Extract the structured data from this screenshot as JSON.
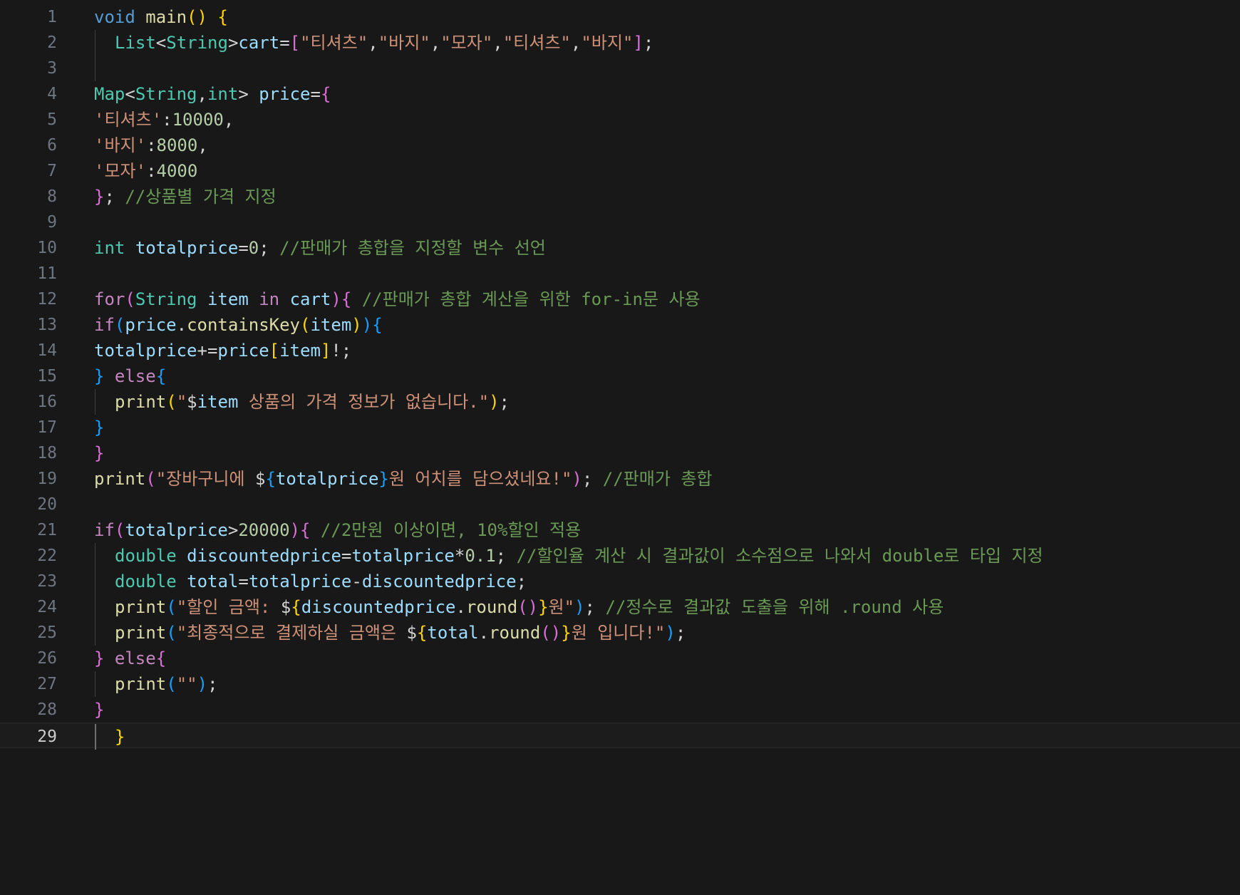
{
  "editor": {
    "lines": [
      {
        "n": "1",
        "indent": 0,
        "tokens": [
          {
            "t": "void",
            "c": "kw"
          },
          {
            "t": " ",
            "c": "pn"
          },
          {
            "t": "main",
            "c": "fn"
          },
          {
            "t": "()",
            "c": "b1"
          },
          {
            "t": " ",
            "c": "pn"
          },
          {
            "t": "{",
            "c": "b1"
          }
        ]
      },
      {
        "n": "2",
        "indent": 1,
        "tokens": [
          {
            "t": "List",
            "c": "ty"
          },
          {
            "t": "<",
            "c": "pn"
          },
          {
            "t": "String",
            "c": "ty"
          },
          {
            "t": ">",
            "c": "pn"
          },
          {
            "t": "cart",
            "c": "var"
          },
          {
            "t": "=",
            "c": "pn"
          },
          {
            "t": "[",
            "c": "b2"
          },
          {
            "t": "\"티셔츠\"",
            "c": "str"
          },
          {
            "t": ",",
            "c": "pn"
          },
          {
            "t": "\"바지\"",
            "c": "str"
          },
          {
            "t": ",",
            "c": "pn"
          },
          {
            "t": "\"모자\"",
            "c": "str"
          },
          {
            "t": ",",
            "c": "pn"
          },
          {
            "t": "\"티셔츠\"",
            "c": "str"
          },
          {
            "t": ",",
            "c": "pn"
          },
          {
            "t": "\"바지\"",
            "c": "str"
          },
          {
            "t": "]",
            "c": "b2"
          },
          {
            "t": ";",
            "c": "pn"
          }
        ]
      },
      {
        "n": "3",
        "indent": 1,
        "tokens": []
      },
      {
        "n": "4",
        "indent": 0,
        "tokens": [
          {
            "t": "Map",
            "c": "ty"
          },
          {
            "t": "<",
            "c": "pn"
          },
          {
            "t": "String",
            "c": "ty"
          },
          {
            "t": ",",
            "c": "pn"
          },
          {
            "t": "int",
            "c": "ty"
          },
          {
            "t": "> ",
            "c": "pn"
          },
          {
            "t": "price",
            "c": "var"
          },
          {
            "t": "=",
            "c": "pn"
          },
          {
            "t": "{",
            "c": "b2"
          }
        ]
      },
      {
        "n": "5",
        "indent": 0,
        "tokens": [
          {
            "t": "'티셔츠'",
            "c": "str"
          },
          {
            "t": ":",
            "c": "pn"
          },
          {
            "t": "10000",
            "c": "num"
          },
          {
            "t": ",",
            "c": "pn"
          }
        ]
      },
      {
        "n": "6",
        "indent": 0,
        "tokens": [
          {
            "t": "'바지'",
            "c": "str"
          },
          {
            "t": ":",
            "c": "pn"
          },
          {
            "t": "8000",
            "c": "num"
          },
          {
            "t": ",",
            "c": "pn"
          }
        ]
      },
      {
        "n": "7",
        "indent": 0,
        "tokens": [
          {
            "t": "'모자'",
            "c": "str"
          },
          {
            "t": ":",
            "c": "pn"
          },
          {
            "t": "4000",
            "c": "num"
          }
        ]
      },
      {
        "n": "8",
        "indent": 0,
        "tokens": [
          {
            "t": "}",
            "c": "b2"
          },
          {
            "t": "; ",
            "c": "pn"
          },
          {
            "t": "//상품별 가격 지정",
            "c": "cm"
          }
        ]
      },
      {
        "n": "9",
        "indent": 0,
        "tokens": []
      },
      {
        "n": "10",
        "indent": 0,
        "tokens": [
          {
            "t": "int",
            "c": "ty"
          },
          {
            "t": " ",
            "c": "pn"
          },
          {
            "t": "totalprice",
            "c": "var"
          },
          {
            "t": "=",
            "c": "pn"
          },
          {
            "t": "0",
            "c": "num"
          },
          {
            "t": "; ",
            "c": "pn"
          },
          {
            "t": "//판매가 총합을 지정할 변수 선언",
            "c": "cm"
          }
        ]
      },
      {
        "n": "11",
        "indent": 0,
        "tokens": []
      },
      {
        "n": "12",
        "indent": 0,
        "tokens": [
          {
            "t": "for",
            "c": "ctrl"
          },
          {
            "t": "(",
            "c": "b2"
          },
          {
            "t": "String",
            "c": "ty"
          },
          {
            "t": " ",
            "c": "pn"
          },
          {
            "t": "item",
            "c": "var"
          },
          {
            "t": " ",
            "c": "pn"
          },
          {
            "t": "in",
            "c": "ctrl"
          },
          {
            "t": " ",
            "c": "pn"
          },
          {
            "t": "cart",
            "c": "var"
          },
          {
            "t": "){",
            "c": "b2"
          },
          {
            "t": " ",
            "c": "pn"
          },
          {
            "t": "//판매가 총합 계산을 위한 for-in문 사용",
            "c": "cm"
          }
        ]
      },
      {
        "n": "13",
        "indent": 0,
        "tokens": [
          {
            "t": "if",
            "c": "ctrl"
          },
          {
            "t": "(",
            "c": "b3"
          },
          {
            "t": "price",
            "c": "var"
          },
          {
            "t": ".",
            "c": "pn"
          },
          {
            "t": "containsKey",
            "c": "fn"
          },
          {
            "t": "(",
            "c": "b1"
          },
          {
            "t": "item",
            "c": "var"
          },
          {
            "t": ")",
            "c": "b1"
          },
          {
            "t": "){",
            "c": "b3"
          }
        ]
      },
      {
        "n": "14",
        "indent": 0,
        "tokens": [
          {
            "t": "totalprice",
            "c": "var"
          },
          {
            "t": "+=",
            "c": "pn"
          },
          {
            "t": "price",
            "c": "var"
          },
          {
            "t": "[",
            "c": "b1"
          },
          {
            "t": "item",
            "c": "var"
          },
          {
            "t": "]",
            "c": "b1"
          },
          {
            "t": "!;",
            "c": "pn"
          }
        ]
      },
      {
        "n": "15",
        "indent": 0,
        "tokens": [
          {
            "t": "}",
            "c": "b3"
          },
          {
            "t": " ",
            "c": "pn"
          },
          {
            "t": "else",
            "c": "ctrl"
          },
          {
            "t": "{",
            "c": "b3"
          }
        ]
      },
      {
        "n": "16",
        "indent": 1,
        "tokens": [
          {
            "t": "print",
            "c": "fn"
          },
          {
            "t": "(",
            "c": "b1"
          },
          {
            "t": "\"",
            "c": "str"
          },
          {
            "t": "$",
            "c": "pn"
          },
          {
            "t": "item",
            "c": "var"
          },
          {
            "t": " 상품의 가격 정보가 없습니다.\"",
            "c": "str"
          },
          {
            "t": ")",
            "c": "b1"
          },
          {
            "t": ";",
            "c": "pn"
          }
        ]
      },
      {
        "n": "17",
        "indent": 0,
        "tokens": [
          {
            "t": "}",
            "c": "b3"
          }
        ]
      },
      {
        "n": "18",
        "indent": 0,
        "tokens": [
          {
            "t": "}",
            "c": "b2"
          }
        ]
      },
      {
        "n": "19",
        "indent": 0,
        "tokens": [
          {
            "t": "print",
            "c": "fn"
          },
          {
            "t": "(",
            "c": "b2"
          },
          {
            "t": "\"장바구니에 ",
            "c": "str"
          },
          {
            "t": "$",
            "c": "pn"
          },
          {
            "t": "{",
            "c": "b3"
          },
          {
            "t": "totalprice",
            "c": "var"
          },
          {
            "t": "}",
            "c": "b3"
          },
          {
            "t": "원 어치를 담으셨네요!\"",
            "c": "str"
          },
          {
            "t": ")",
            "c": "b2"
          },
          {
            "t": "; ",
            "c": "pn"
          },
          {
            "t": "//판매가 총합",
            "c": "cm"
          }
        ]
      },
      {
        "n": "20",
        "indent": 0,
        "tokens": []
      },
      {
        "n": "21",
        "indent": 0,
        "tokens": [
          {
            "t": "if",
            "c": "ctrl"
          },
          {
            "t": "(",
            "c": "b2"
          },
          {
            "t": "totalprice",
            "c": "var"
          },
          {
            "t": ">",
            "c": "pn"
          },
          {
            "t": "20000",
            "c": "num"
          },
          {
            "t": "){",
            "c": "b2"
          },
          {
            "t": " ",
            "c": "pn"
          },
          {
            "t": "//2만원 이상이면, 10%할인 적용",
            "c": "cm"
          }
        ]
      },
      {
        "n": "22",
        "indent": 1,
        "tokens": [
          {
            "t": "double",
            "c": "ty"
          },
          {
            "t": " ",
            "c": "pn"
          },
          {
            "t": "discountedprice",
            "c": "var"
          },
          {
            "t": "=",
            "c": "pn"
          },
          {
            "t": "totalprice",
            "c": "var"
          },
          {
            "t": "*",
            "c": "pn"
          },
          {
            "t": "0.1",
            "c": "num"
          },
          {
            "t": "; ",
            "c": "pn"
          },
          {
            "t": "//할인율 계산 시 결과값이 소수점으로 나와서 double로 타입 지정",
            "c": "cm"
          }
        ]
      },
      {
        "n": "23",
        "indent": 1,
        "tokens": [
          {
            "t": "double",
            "c": "ty"
          },
          {
            "t": " ",
            "c": "pn"
          },
          {
            "t": "total",
            "c": "var"
          },
          {
            "t": "=",
            "c": "pn"
          },
          {
            "t": "totalprice",
            "c": "var"
          },
          {
            "t": "-",
            "c": "pn"
          },
          {
            "t": "discountedprice",
            "c": "var"
          },
          {
            "t": ";",
            "c": "pn"
          }
        ]
      },
      {
        "n": "24",
        "indent": 1,
        "tokens": [
          {
            "t": "print",
            "c": "fn"
          },
          {
            "t": "(",
            "c": "b3"
          },
          {
            "t": "\"할인 금액: ",
            "c": "str"
          },
          {
            "t": "$",
            "c": "pn"
          },
          {
            "t": "{",
            "c": "b1"
          },
          {
            "t": "discountedprice",
            "c": "var"
          },
          {
            "t": ".",
            "c": "pn"
          },
          {
            "t": "round",
            "c": "fn"
          },
          {
            "t": "()",
            "c": "b2"
          },
          {
            "t": "}",
            "c": "b1"
          },
          {
            "t": "원\"",
            "c": "str"
          },
          {
            "t": ")",
            "c": "b3"
          },
          {
            "t": "; ",
            "c": "pn"
          },
          {
            "t": "//정수로 결과값 도출을 위해 .round 사용",
            "c": "cm"
          }
        ]
      },
      {
        "n": "25",
        "indent": 1,
        "tokens": [
          {
            "t": "print",
            "c": "fn"
          },
          {
            "t": "(",
            "c": "b3"
          },
          {
            "t": "\"최종적으로 결제하실 금액은 ",
            "c": "str"
          },
          {
            "t": "$",
            "c": "pn"
          },
          {
            "t": "{",
            "c": "b1"
          },
          {
            "t": "total",
            "c": "var"
          },
          {
            "t": ".",
            "c": "pn"
          },
          {
            "t": "round",
            "c": "fn"
          },
          {
            "t": "()",
            "c": "b2"
          },
          {
            "t": "}",
            "c": "b1"
          },
          {
            "t": "원 입니다!\"",
            "c": "str"
          },
          {
            "t": ")",
            "c": "b3"
          },
          {
            "t": ";",
            "c": "pn"
          }
        ]
      },
      {
        "n": "26",
        "indent": 0,
        "tokens": [
          {
            "t": "}",
            "c": "b2"
          },
          {
            "t": " ",
            "c": "pn"
          },
          {
            "t": "else",
            "c": "ctrl"
          },
          {
            "t": "{",
            "c": "b2"
          }
        ]
      },
      {
        "n": "27",
        "indent": 1,
        "tokens": [
          {
            "t": "print",
            "c": "fn"
          },
          {
            "t": "(",
            "c": "b3"
          },
          {
            "t": "\"\"",
            "c": "str"
          },
          {
            "t": ")",
            "c": "b3"
          },
          {
            "t": ";",
            "c": "pn"
          }
        ]
      },
      {
        "n": "28",
        "indent": 0,
        "tokens": [
          {
            "t": "}",
            "c": "b2"
          }
        ]
      },
      {
        "n": "29",
        "indent": 1,
        "current": true,
        "tokens": [
          {
            "t": "}",
            "c": "b1"
          }
        ]
      }
    ]
  }
}
